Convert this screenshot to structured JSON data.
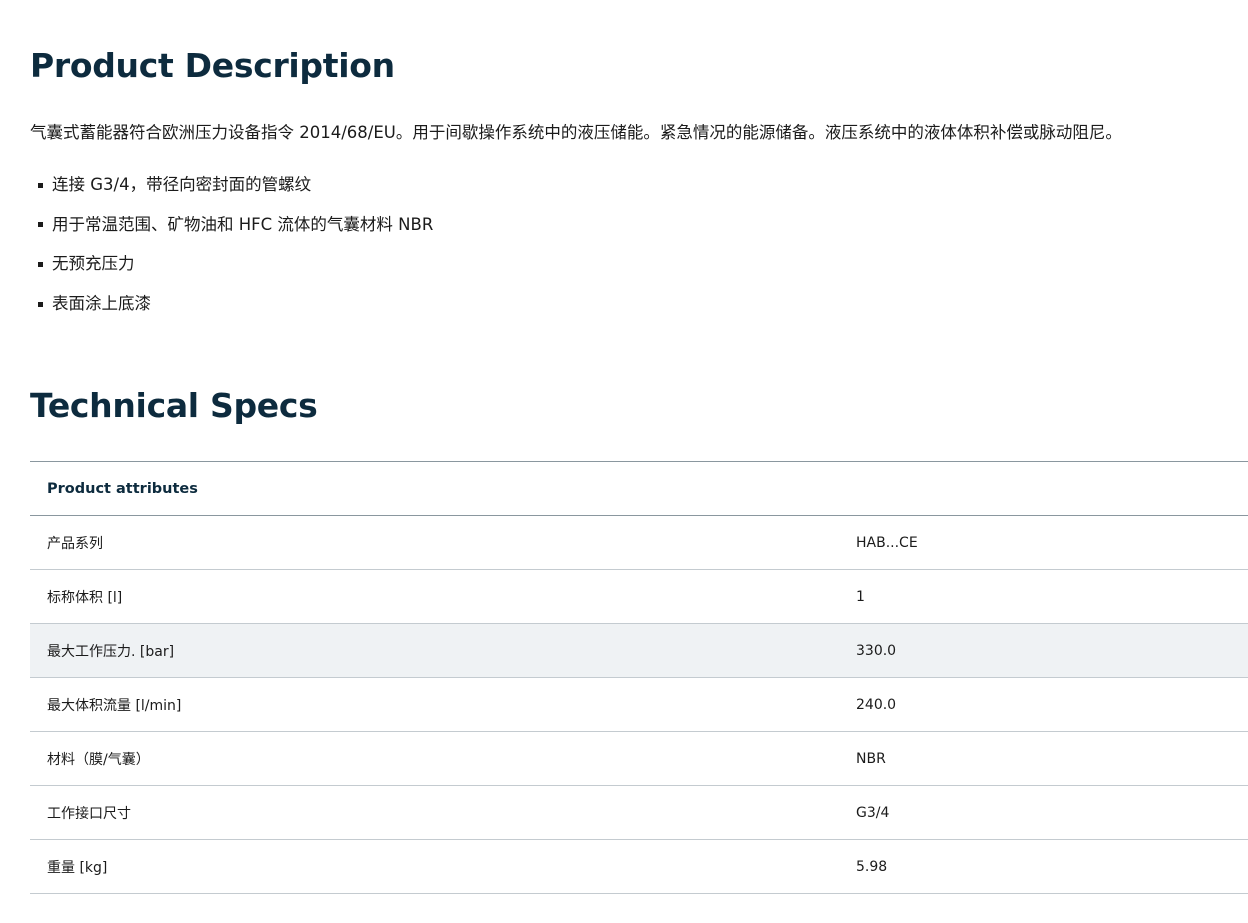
{
  "description": {
    "title": "Product Description",
    "text": "气囊式蓄能器符合欧洲压力设备指令 2014/68/EU。用于间歇操作系统中的液压储能。紧急情况的能源储备。液压系统中的液体体积补偿或脉动阻尼。",
    "features": [
      "连接 G3/4，带径向密封面的管螺纹",
      "用于常温范围、矿物油和 HFC 流体的气囊材料 NBR",
      "无预充压力",
      "表面涂上底漆"
    ]
  },
  "specs": {
    "title": "Technical Specs",
    "table_header": "Product attributes",
    "rows": [
      {
        "label": "产品系列",
        "value": "HAB...CE"
      },
      {
        "label": "标称体积 [l]",
        "value": "1"
      },
      {
        "label": "最大工作压力. [bar]",
        "value": "330.0"
      },
      {
        "label": "最大体积流量 [l/min]",
        "value": "240.0"
      },
      {
        "label": "材料（膜/气囊）",
        "value": "NBR"
      },
      {
        "label": "工作接口尺寸",
        "value": "G3/4"
      },
      {
        "label": "重量 [kg]",
        "value": "5.98"
      }
    ]
  },
  "colors": {
    "heading": "#0d2b3e",
    "text": "#1b1b1b",
    "highlight_row": "#eff2f4",
    "row_border": "#c4cbd0"
  }
}
